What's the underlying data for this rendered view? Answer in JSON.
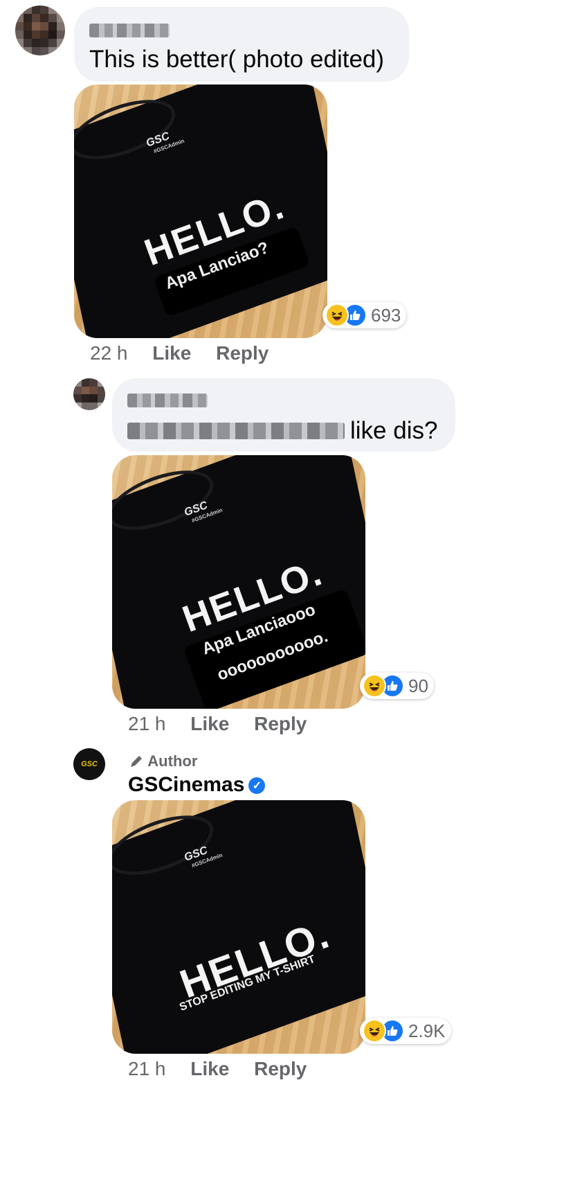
{
  "comments": [
    {
      "text": "This is better( photo edited)",
      "shirt": {
        "brand": "GSC",
        "tag": "#GSCAdmin",
        "headline": "HELLO.",
        "subline": "Apa Lanciao?"
      },
      "reactions": {
        "count": "693"
      },
      "time": "22 h",
      "like_label": "Like",
      "reply_label": "Reply"
    },
    {
      "text": "like dis?",
      "shirt": {
        "brand": "GSC",
        "tag": "#GSCAdmin",
        "headline": "HELLO.",
        "subline": "Apa Lanciaooo",
        "subline2": "ooooooooooo."
      },
      "reactions": {
        "count": "90"
      },
      "time": "21 h",
      "like_label": "Like",
      "reply_label": "Reply"
    },
    {
      "author_tag": "Author",
      "name": "GSCinemas",
      "avatar_text": "GSC",
      "verified_icon": "✓",
      "shirt": {
        "brand": "GSC",
        "tag": "#GSCAdmin",
        "headline": "HELLO.",
        "subline": "STOP EDITING MY T-SHIRT"
      },
      "reactions": {
        "count": "2.9K"
      },
      "time": "21 h",
      "like_label": "Like",
      "reply_label": "Reply"
    }
  ],
  "colors": {
    "haha": "#f7c21d",
    "like": "#1877f2",
    "bubble": "#f0f2f5",
    "meta": "#65676b"
  },
  "icons": {
    "haha": "haha-reaction-icon",
    "like": "like-reaction-icon",
    "pen": "pen-icon",
    "verified": "verified-badge-icon"
  }
}
